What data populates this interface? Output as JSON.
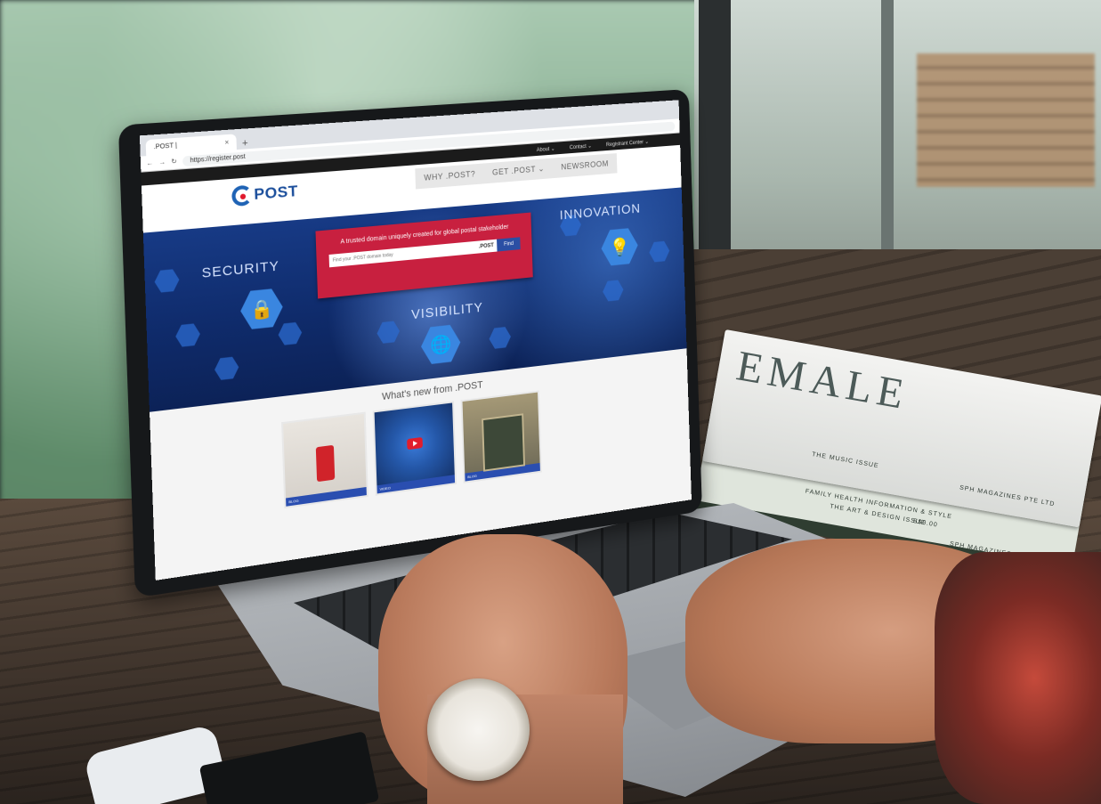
{
  "browser": {
    "tab_title": ".POST |",
    "tab_close": "×",
    "new_tab": "+",
    "url": "https://register.post"
  },
  "topnav": [
    "About ⌄",
    "Contact ⌄",
    "Registrant Center ⌄"
  ],
  "logo": {
    "text": "POST"
  },
  "mainnav": [
    "WHY .POST?",
    "GET .POST ⌄",
    "NEWSROOM"
  ],
  "hero": {
    "labels": {
      "security": "SECURITY",
      "innovation": "INNOVATION",
      "visibility": "VISIBILITY"
    },
    "tagline": "A trusted domain uniquely created for global postal stakeholder",
    "search_placeholder": "Find your .POST domain today",
    "suffix": ".POST",
    "find_label": "Find"
  },
  "news": {
    "title": "What's new from .POST",
    "cards": [
      {
        "caption": "BLOG"
      },
      {
        "caption": "VIDEO"
      },
      {
        "caption": "BLOG"
      }
    ]
  },
  "magazines": {
    "cover_title": "EMALE",
    "lines": [
      "THE MUSIC ISSUE",
      "SPH MAGAZINES PTE LTD",
      "FAMILY HEALTH INFORMATION & STYLE",
      "THE ART & DESIGN ISSUE",
      "S$0.00",
      "SPH MAGAZINES PTE LTD"
    ]
  }
}
